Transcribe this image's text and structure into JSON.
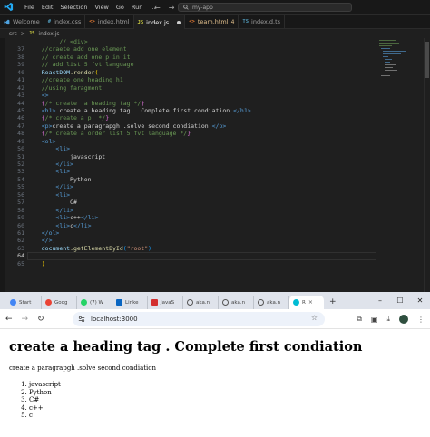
{
  "vscode": {
    "menu": [
      "File",
      "Edit",
      "Selection",
      "View",
      "Go",
      "Run",
      "..."
    ],
    "nav_back": "←",
    "nav_forward": "→",
    "search_text": "my-app",
    "tabs": [
      {
        "icon": "",
        "label": "Welcome",
        "color": "#4fa3e0"
      },
      {
        "icon": "#",
        "label": "index.css",
        "color": "#519aba"
      },
      {
        "icon": "<>",
        "label": "index.html",
        "color": "#e37933"
      },
      {
        "icon": "JS",
        "label": "index.js",
        "color": "#cbcb41",
        "active": true
      },
      {
        "icon": "<>",
        "label": "team.html",
        "badge": "4",
        "color": "#e37933"
      },
      {
        "icon": "TS",
        "label": "index.d.ts",
        "color": "#519aba"
      }
    ],
    "breadcrumb": {
      "folder": "src",
      "sep": ">",
      "js_icon": "JS",
      "file": "index.js"
    }
  },
  "code": {
    "line_numbers": [
      "",
      "37",
      "38",
      "39",
      "40",
      "41",
      "42",
      "43",
      "44",
      "45",
      "46",
      "47",
      "48",
      "49",
      "50",
      "51",
      "52",
      "53",
      "54",
      "55",
      "56",
      "57",
      "58",
      "59",
      "60",
      "61",
      "62",
      "63",
      "64",
      "65"
    ],
    "top_comment": "// <div>",
    "l37": "//craete add one element",
    "l38": "// create add one p in it",
    "l39": "// add list 5 fvt language",
    "l40_obj": "ReactDOM",
    "l40_fn": ".render",
    "l40_paren": "(",
    "l41": "//create one heading h1",
    "l42": "//using faragment",
    "l43": "<>",
    "l44_open": "{",
    "l44_cm": "/* create  a heading tag */",
    "l44_close": "}",
    "l45_open": "<h1>",
    "l45_txt": " create a heading tag . Complete first condiation ",
    "l45_close": "</h1>",
    "l46_open": "{",
    "l46_cm": "/* create a p  */",
    "l46_close": "}",
    "l47_open": "<p>",
    "l47_txt": "create a paragrapgh .solve second condiation ",
    "l47_close": "</p>",
    "l48_open": "{",
    "l48_cm": "/* create a order list 5 fvt language */",
    "l48_close": "}",
    "l49": "<ol>",
    "l50": "<li>",
    "l51": "javascript",
    "l52": "</li>",
    "l53": "<li>",
    "l54": "Python",
    "l55": "</li>",
    "l56": "<li>",
    "l57": "C#",
    "l58": "</li>",
    "l59_open": "<li>",
    "l59_txt": "c++",
    "l59_close": "</li>",
    "l60_open": "<li>",
    "l60_txt": "c",
    "l60_close": "</li>",
    "l61": "</ol>",
    "l62": "</>,",
    "l63_obj": "document",
    "l63_fn": ".getElementById",
    "l63_p1": "(",
    "l63_str": "\"root\"",
    "l63_p2": ")",
    "l65": ")"
  },
  "browser": {
    "tabs": [
      {
        "label": "Start",
        "color": "#4285f4"
      },
      {
        "label": "Goog",
        "color": "#ea4335"
      },
      {
        "label": "(7) W",
        "color": "#25d366"
      },
      {
        "label": "Linke",
        "color": "#0a66c2"
      },
      {
        "label": "JavaS",
        "color": "#d32f2f"
      },
      {
        "label": "aka.n",
        "color": "#555555"
      },
      {
        "label": "aka.n",
        "color": "#555555"
      },
      {
        "label": "aka.n",
        "color": "#555555"
      },
      {
        "label": "R",
        "color": "#00bcd4",
        "active": true
      }
    ],
    "tab_close": "×",
    "new_tab": "+",
    "win_min": "–",
    "win_max": "☐",
    "win_close": "✕",
    "back": "←",
    "forward": "→",
    "reload": "↻",
    "url": "localhost:3000",
    "star": "☆",
    "ext": "⧉",
    "sidebar": "▣",
    "download": "⤓",
    "menu": "⋮"
  },
  "page": {
    "heading": "create a heading tag . Complete first condiation",
    "paragraph": "create a paragrapgh .solve second condiation",
    "list": [
      "javascript",
      "Python",
      "C#",
      "c++",
      "c"
    ]
  }
}
